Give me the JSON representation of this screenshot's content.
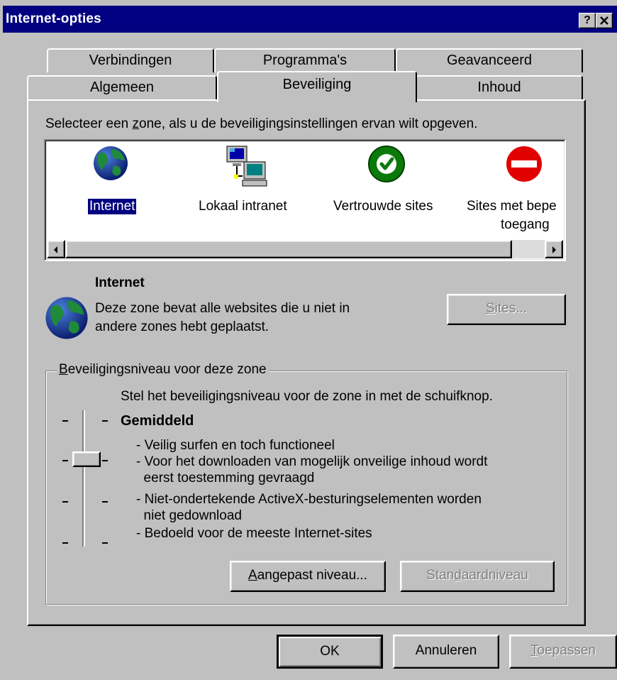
{
  "window": {
    "title": "Internet-opties",
    "help_button": "?",
    "close_button": "×"
  },
  "tabs": {
    "row1": [
      "Verbindingen",
      "Programma's",
      "Geavanceerd"
    ],
    "row2": [
      "Algemeen",
      "Beveiliging",
      "Inhoud"
    ],
    "active": "Beveiliging"
  },
  "security": {
    "instruction_prefix": "Selecteer een ",
    "instruction_accel": "z",
    "instruction_suffix": "one, als u de beveiligingsinstellingen ervan wilt opgeven.",
    "zones": [
      {
        "label": "Internet",
        "icon": "globe-icon",
        "selected": true
      },
      {
        "label": "Lokaal intranet",
        "icon": "network-computers-icon",
        "selected": false
      },
      {
        "label": "Vertrouwde sites",
        "icon": "green-check-icon",
        "selected": false
      },
      {
        "label_line1": "Sites met bepe",
        "label_line2": "toegang",
        "icon": "red-no-entry-icon",
        "selected": false
      }
    ],
    "zone_title": "Internet",
    "zone_description_line1": "Deze zone bevat alle websites die u niet in",
    "zone_description_line2": "andere zones hebt geplaatst.",
    "sites_button": {
      "accel": "S",
      "rest": "ites..."
    }
  },
  "level_group": {
    "title_accel": "B",
    "title_rest": "eveiligingsniveau voor deze zone",
    "instruction": "Stel het beveiligingsniveau voor de zone in met de schuifknop.",
    "level_name": "Gemiddeld",
    "slider_value": "2 of 4",
    "bullets": [
      "- Veilig surfen en toch functioneel",
      "- Voor het downloaden van mogelijk onveilige inhoud wordt",
      "  eerst toestemming gevraagd",
      "- Niet-ondertekende ActiveX-besturingselementen worden",
      "  niet gedownload",
      "- Bedoeld voor de meeste Internet-sites"
    ],
    "custom_button": {
      "accel": "A",
      "rest": "angepast niveau..."
    },
    "default_button": {
      "pre": "Stan",
      "accel": "d",
      "rest": "aardniveau"
    }
  },
  "footer": {
    "ok": "OK",
    "cancel": "Annuleren",
    "apply_accel": "T",
    "apply_rest": "oepassen"
  },
  "colors": {
    "titlebar": "#000080",
    "face": "#c0c0c0",
    "selection": "#000080"
  }
}
